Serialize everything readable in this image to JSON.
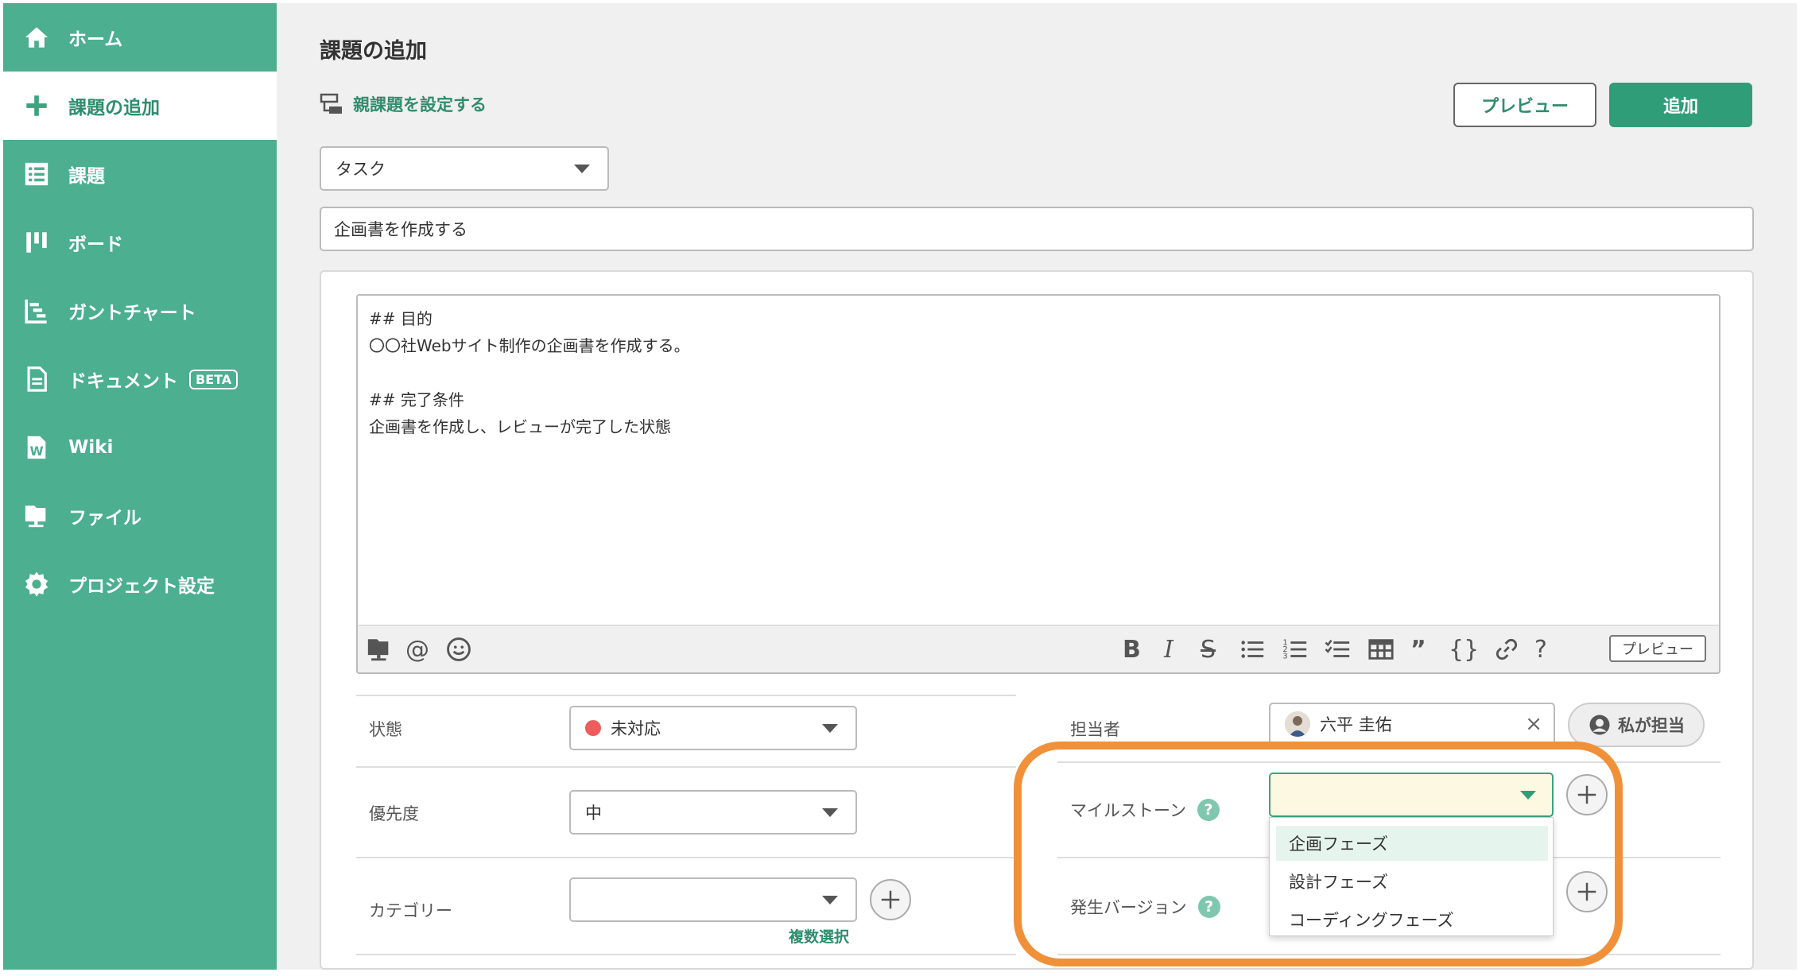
{
  "sidebar": {
    "items": [
      {
        "label": "ホーム",
        "icon": "home-icon"
      },
      {
        "label": "課題の追加",
        "icon": "plus-icon"
      },
      {
        "label": "課題",
        "icon": "list-icon"
      },
      {
        "label": "ボード",
        "icon": "board-icon"
      },
      {
        "label": "ガントチャート",
        "icon": "gantt-icon"
      },
      {
        "label": "ドキュメント",
        "icon": "document-icon",
        "badge": "BETA"
      },
      {
        "label": "Wiki",
        "icon": "wiki-icon"
      },
      {
        "label": "ファイル",
        "icon": "folder-icon"
      },
      {
        "label": "プロジェクト設定",
        "icon": "gear-icon"
      }
    ],
    "active_index": 1
  },
  "header": {
    "title": "課題の追加",
    "parent_link": "親課題を設定する",
    "preview_label": "プレビュー",
    "add_label": "追加"
  },
  "form": {
    "issue_type": "タスク",
    "subject": "企画書を作成する",
    "description": "## 目的\n〇〇社Webサイト制作の企画書を作成する。\n\n## 完了条件\n企画書を作成し、レビューが完了した状態",
    "toolbar_preview_label": "プレビュー",
    "fields": {
      "status": {
        "label": "状態",
        "value": "未対応",
        "color": "#ee5c5c"
      },
      "priority": {
        "label": "優先度",
        "value": "中"
      },
      "category": {
        "label": "カテゴリー",
        "value": "",
        "multi_label": "複数選択"
      },
      "assignee": {
        "label": "担当者",
        "value": "六平 圭佑",
        "assign_me_label": "私が担当"
      },
      "milestone": {
        "label": "マイルストーン",
        "help": "?",
        "value": ""
      },
      "version": {
        "label": "発生バージョン",
        "help": "?"
      }
    },
    "milestone_options": [
      "企画フェーズ",
      "設計フェーズ",
      "コーディングフェーズ"
    ]
  },
  "colors": {
    "sidebar_bg": "#4caf8f",
    "accent": "#2f9e78",
    "highlight": "#f0913a"
  }
}
